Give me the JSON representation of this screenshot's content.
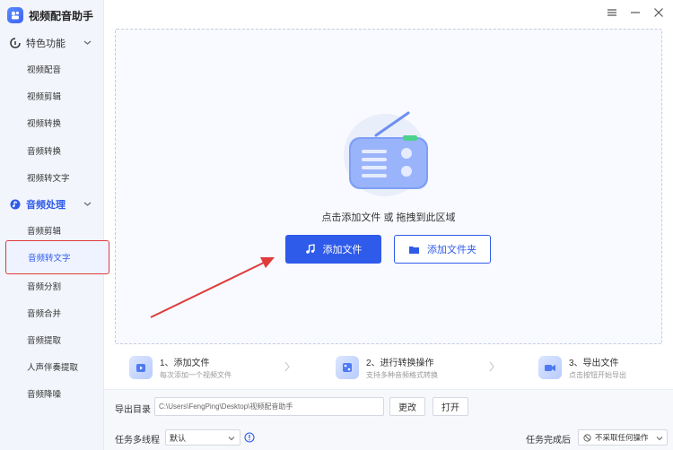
{
  "app": {
    "title": "视频配音助手"
  },
  "sidebar": {
    "sections": [
      {
        "label": "特色功能",
        "items": [
          "视频配音",
          "视频剪辑",
          "视频转换",
          "音频转换",
          "视频转文字"
        ]
      },
      {
        "label": "音频处理",
        "items": [
          "音频剪辑",
          "音频转文字",
          "音频分割",
          "音频合并",
          "音频提取",
          "人声伴奏提取",
          "音频降噪"
        ]
      }
    ],
    "selected_item": "音频转文字"
  },
  "dropzone": {
    "hint": "点击添加文件 或 拖拽到此区域",
    "add_file_label": "添加文件",
    "add_folder_label": "添加文件夹"
  },
  "steps": [
    {
      "title": "1、添加文件",
      "desc": "每次添加一个视频文件"
    },
    {
      "title": "2、进行转换操作",
      "desc": "支持多种音频格式转换"
    },
    {
      "title": "3、导出文件",
      "desc": "点击按钮开始导出"
    }
  ],
  "footer": {
    "export_label": "导出目录",
    "export_path": "C:\\Users\\FengPing\\Desktop\\视频配音助手",
    "change_label": "更改",
    "open_label": "打开",
    "multithread_label": "任务多线程",
    "multithread_value": "默认",
    "after_label": "任务完成后",
    "after_value": "不采取任何操作"
  },
  "colors": {
    "accent": "#2f5bea",
    "highlight_box": "#e03a3a",
    "sidebar_bg": "#f2f5fb"
  }
}
